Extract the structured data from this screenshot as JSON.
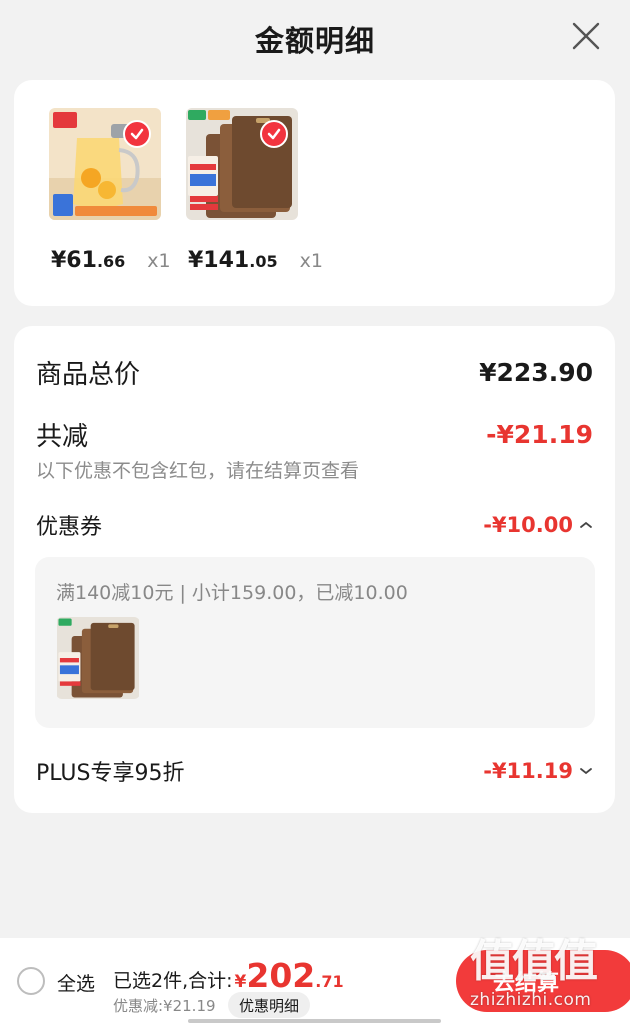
{
  "header": {
    "title": "金额明细"
  },
  "products": [
    {
      "price_int": "¥61",
      "price_dec": ".66",
      "qty": "x1",
      "thumb_icon": "glass-pitcher-product-image"
    },
    {
      "price_int": "¥141",
      "price_dec": ".05",
      "qty": "x1",
      "thumb_icon": "cutting-board-product-image"
    }
  ],
  "detail": {
    "total_label": "商品总价",
    "total_value": "¥223.90",
    "reduce_label": "共减",
    "reduce_value": "-¥21.19",
    "hint": "以下优惠不包含红包，请在结算页查看",
    "coupon_label": "优惠券",
    "coupon_value": "-¥10.00",
    "coupon_desc": "满140减10元 | 小计159.00，已减10.00",
    "plus_label": "PLUS专享95折",
    "plus_value": "-¥11.19"
  },
  "footer": {
    "select_all": "全选",
    "selected_summary": "已选2件,合计:",
    "total_yen": "¥",
    "total_int": "202",
    "total_dec": ".71",
    "discount_line": "优惠减:¥21.19",
    "detail_pill": "优惠明细",
    "checkout": "去结算"
  },
  "watermark": {
    "logo": "值值值",
    "url": "zhizhizhi.com"
  },
  "colors": {
    "accent_red": "#e83530",
    "button_red": "#f23b3b",
    "background": "#f2f2f2"
  }
}
